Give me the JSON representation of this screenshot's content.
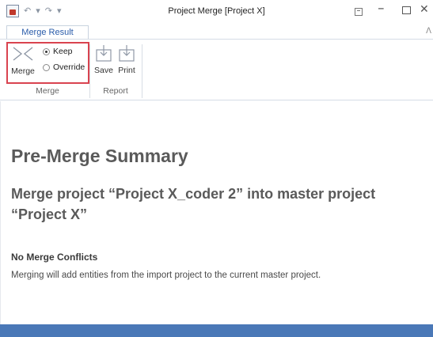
{
  "window": {
    "title": "Project Merge [Project X]"
  },
  "quick_access": {
    "undo_glyph": "↶",
    "redo_glyph": "↷",
    "customize_glyph": "▾"
  },
  "tabs": [
    {
      "label": "Merge Result"
    }
  ],
  "ribbon": {
    "merge_group": {
      "label": "Merge",
      "merge_button": "Merge",
      "options": [
        {
          "label": "Keep",
          "selected": true
        },
        {
          "label": "Override",
          "selected": false
        }
      ]
    },
    "report_group": {
      "label": "Report",
      "save_button": "Save",
      "print_button": "Print"
    }
  },
  "content": {
    "heading": "Pre-Merge Summary",
    "subheading": "Merge project “Project X_coder 2” into master project “Project X”",
    "conflicts_title": "No Merge Conflicts",
    "description": "Merging will add entities from the import project to the current master project."
  },
  "colors": {
    "accent": "#2a5caa",
    "highlight": "#d9434f",
    "statusbar": "#4a78b7"
  },
  "icons": [
    "app-icon",
    "undo-icon",
    "redo-icon",
    "merge-icon",
    "save-icon",
    "print-icon",
    "close-icon"
  ]
}
